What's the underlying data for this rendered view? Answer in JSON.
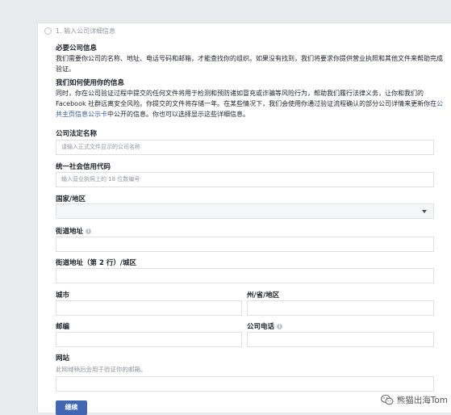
{
  "step": {
    "label": "1. 输入公司详细信息"
  },
  "sections": {
    "required_title": "必要公司信息",
    "required_text": "我们需要你公司的名称、地址、电话号码和邮箱，才能查找你的组织。如果没有找到，我们将要求你提供营业执照和其他文件来帮助完成验证。",
    "usage_title": "我们如何使用你的信息",
    "usage_text_1": "同时，你在公司验证过程中提交的任何文件将用于检测和预防诸如冒充或诈骗等风险行为，帮助我们履行法律义务，让你和我们的 Facebook 社群远离安全风险。你提交的文件将存储一年。在某些情况下，我们会使用你通过验证流程确认的部分公司详情来更新你在",
    "usage_link": "公共主页信息公示卡",
    "usage_text_2": "中公开的信息。你也可以选择显示这些详细信息。"
  },
  "form": {
    "legal_name": {
      "label": "公司法定名称",
      "placeholder": "请输入正式文件显示的公司名称"
    },
    "credit_code": {
      "label": "统一社会信用代码",
      "placeholder": "输入营业执照上的 18 位数编号"
    },
    "country": {
      "label": "国家/地区",
      "value": ""
    },
    "street": {
      "label": "街道地址"
    },
    "street2": {
      "label": "街道地址（第 2 行）/城区"
    },
    "city": {
      "label": "城市"
    },
    "state": {
      "label": "州/省/地区"
    },
    "zip": {
      "label": "邮编"
    },
    "phone": {
      "label": "公司电话"
    },
    "website": {
      "label": "网站",
      "help": "此网域稍后会用于验证你的邮箱。"
    }
  },
  "continue_label": "继续",
  "watermark": {
    "text": "熊猫出海Tom",
    "icon": "wechat-icon"
  },
  "colors": {
    "button": "#4267b2",
    "link": "#365899",
    "page_bg": "#e9ebee"
  }
}
